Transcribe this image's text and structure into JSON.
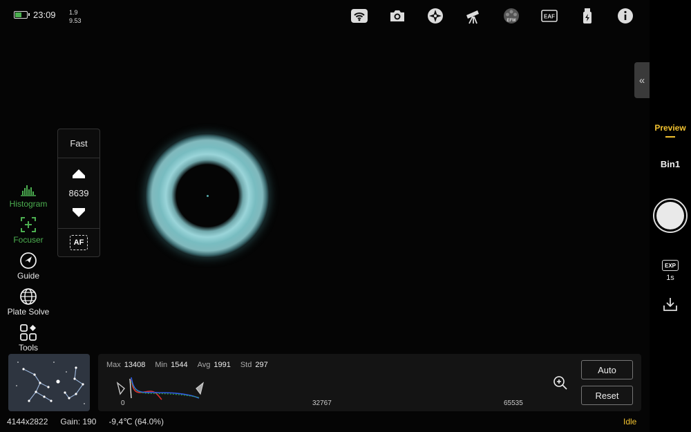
{
  "status": {
    "time": "23:09",
    "fw_line1": "1.9",
    "fw_line2": "9.53",
    "battery_level": 0.55
  },
  "top_icons": [
    "wifi-icon",
    "camera-icon",
    "mount-icon",
    "telescope-icon",
    "efw-icon",
    "eaf-icon",
    "usb-power-icon",
    "info-icon"
  ],
  "top_icon_labels": {
    "efw": "EFW",
    "eaf": "EAF"
  },
  "collapse_label": "«",
  "focuser": {
    "speed": "Fast",
    "position": "8639",
    "af_label": "AF"
  },
  "left_nav": [
    {
      "label": "Histogram",
      "icon": "histogram-icon",
      "active": true
    },
    {
      "label": "Focuser",
      "icon": "focuser-icon",
      "active": true
    },
    {
      "label": "Guide",
      "icon": "guide-icon",
      "active": false
    },
    {
      "label": "Plate Solve",
      "icon": "globe-icon",
      "active": false
    },
    {
      "label": "Tools",
      "icon": "tools-icon",
      "active": false
    }
  ],
  "histogram": {
    "max_label": "Max",
    "max": "13408",
    "min_label": "Min",
    "min": "1544",
    "avg_label": "Avg",
    "avg": "1991",
    "std_label": "Std",
    "std": "297",
    "axis": [
      "0",
      "32767",
      "65535"
    ],
    "auto_label": "Auto",
    "reset_label": "Reset"
  },
  "bottom": {
    "resolution": "4144x2822",
    "gain": "Gain: 190",
    "temp": "-9,4℃ (64.0%)",
    "state": "Idle"
  },
  "right": {
    "mode": "Preview",
    "bin": "Bin1",
    "exp_badge": "EXP",
    "exposure": "1s"
  },
  "colors": {
    "accent": "#f2c230",
    "active_green": "#4caf50",
    "ring": "#a8e6ea"
  }
}
